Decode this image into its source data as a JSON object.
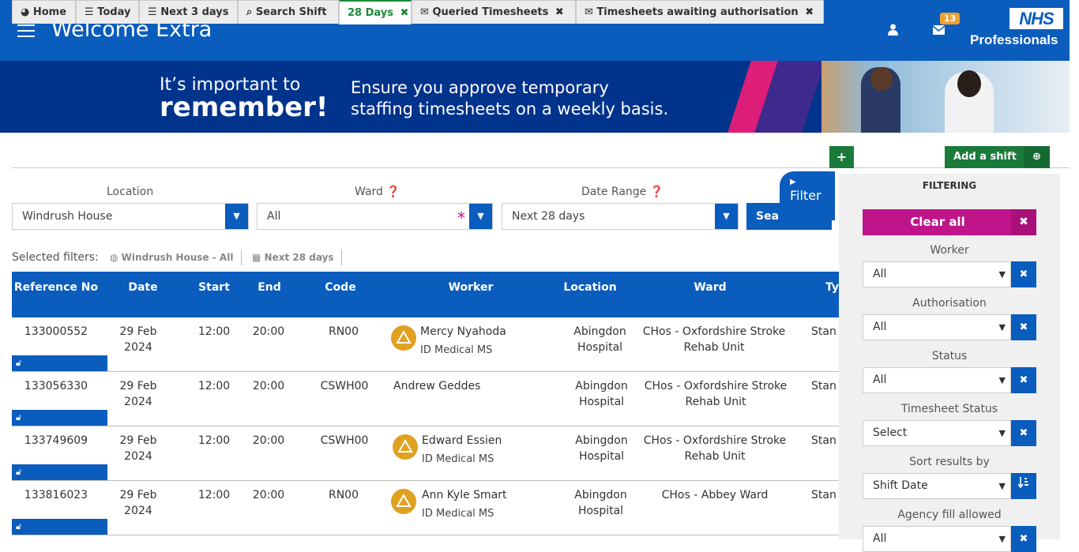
{
  "header": {
    "title": "Welcome Extra",
    "mail_count": "13",
    "logo_nhs": "NHS",
    "logo_sub": "Professionals"
  },
  "banner": {
    "line1": "It’s important to",
    "line2": "remember!",
    "message_l1": "Ensure you approve temporary",
    "message_l2": "staffing timesheets on a weekly basis."
  },
  "tabs": [
    {
      "icon": "◕",
      "label": "Home"
    },
    {
      "icon": "☰",
      "label": "Today"
    },
    {
      "icon": "☰",
      "label": "Next 3 days"
    },
    {
      "icon": "⌕",
      "label": "Search Shift"
    },
    {
      "label": "28 Days",
      "close": "✖"
    },
    {
      "icon": "✉",
      "label": "Queried Timesheets",
      "close": "✖"
    },
    {
      "icon": "✉",
      "label": "Timesheets awaiting authorisation",
      "close": "✖"
    }
  ],
  "add_tab": "+",
  "add_shift": {
    "label": "Add a shift",
    "icon": "⊕"
  },
  "filters": {
    "location_label": "Location",
    "location_value": "Windrush House",
    "ward_label": "Ward",
    "ward_value": "All",
    "date_label": "Date Range",
    "date_value": "Next 28 days",
    "search_label": "Search",
    "filter_toggle": "Filter",
    "selected_label": "Selected filters:",
    "chip1": "Windrush House - All",
    "chip2": "Next 28 days"
  },
  "table": {
    "headers": [
      "Reference No",
      "Date",
      "Start",
      "End",
      "Code",
      "Worker",
      "Location",
      "Ward",
      "Ty"
    ],
    "rows": [
      {
        "ref": "133000552",
        "date": "29 Feb 2024",
        "start": "12:00",
        "end": "20:00",
        "code": "RN00",
        "worker": "Mercy Nyahoda",
        "agency": "ID Medical MS",
        "location": "Abingdon Hospital",
        "ward": "CHos - Oxfordshire Stroke Rehab Unit",
        "type": "Stan"
      },
      {
        "ref": "133056330",
        "date": "29 Feb 2024",
        "start": "12:00",
        "end": "20:00",
        "code": "CSWH00",
        "worker": "Andrew Geddes",
        "agency": "",
        "location": "Abingdon Hospital",
        "ward": "CHos - Oxfordshire Stroke Rehab Unit",
        "type": "Stan"
      },
      {
        "ref": "133749609",
        "date": "29 Feb 2024",
        "start": "12:00",
        "end": "20:00",
        "code": "CSWH00",
        "worker": "Edward Essien",
        "agency": "ID Medical MS",
        "location": "Abingdon Hospital",
        "ward": "CHos - Oxfordshire Stroke Rehab Unit",
        "type": "Stan"
      },
      {
        "ref": "133816023",
        "date": "29 Feb 2024",
        "start": "12:00",
        "end": "20:00",
        "code": "RN00",
        "worker": "Ann Kyle Smart",
        "agency": "ID Medical MS",
        "location": "Abingdon Hospital",
        "ward": "CHos - Abbey Ward",
        "type": "Stan"
      }
    ]
  },
  "sidebar": {
    "title": "FILTERING",
    "clear_all": "Clear all",
    "items": [
      {
        "label": "Worker",
        "value": "All"
      },
      {
        "label": "Authorisation",
        "value": "All"
      },
      {
        "label": "Status",
        "value": "All"
      },
      {
        "label": "Timesheet Status",
        "value": "Select"
      },
      {
        "label": "Sort results by",
        "value": "Shift Date"
      },
      {
        "label": "Agency fill allowed",
        "value": "All"
      }
    ]
  },
  "colors": {
    "primary": "#0a5cbd",
    "green": "#1a7a3a",
    "magenta": "#c0148a",
    "avatar": "#e0a020"
  }
}
